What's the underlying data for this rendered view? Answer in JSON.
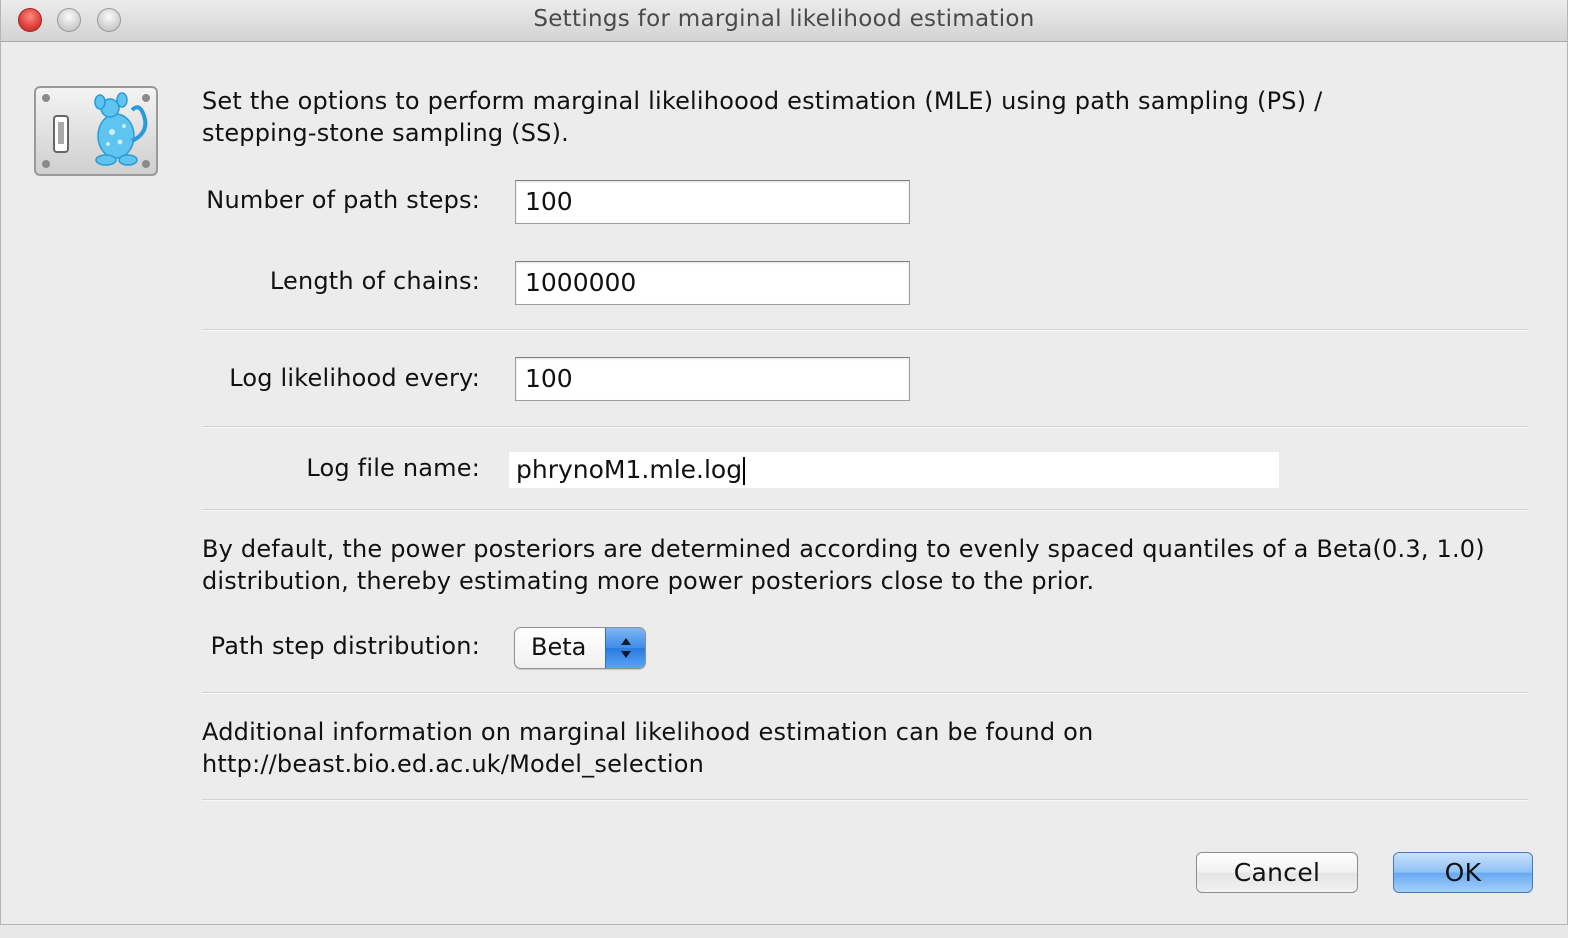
{
  "window": {
    "title": "Settings for marginal likelihood estimation"
  },
  "intro_text_line1": "Set the options to perform marginal likelihoood estimation (MLE) using path sampling (PS) /",
  "intro_text_line2": "stepping-stone sampling (SS).",
  "fields": {
    "path_steps": {
      "label": "Number of path steps:",
      "value": "100"
    },
    "chain_length": {
      "label": "Length of chains:",
      "value": "1000000"
    },
    "log_every": {
      "label": "Log likelihood every:",
      "value": "100"
    },
    "log_file": {
      "label": "Log file name:",
      "value": "phrynoM1.mle.log"
    }
  },
  "default_text_line1": "By default, the power posteriors are determined according to evenly spaced quantiles of a Beta(0.3, 1.0)",
  "default_text_line2": "distribution, thereby estimating more power posteriors close to the prior.",
  "distribution": {
    "label": "Path step distribution:",
    "selected": "Beta"
  },
  "info_text_line1": "Additional information on marginal likelihood estimation can be found on",
  "info_text_line2": "http://beast.bio.ed.ac.uk/Model_selection",
  "buttons": {
    "cancel": "Cancel",
    "ok": "OK"
  },
  "colors": {
    "window_bg": "#ececec",
    "default_button_blue": "#68a9f1",
    "close_red": "#e0443e"
  },
  "icons": {
    "app": "beast-app-icon",
    "close": "close-icon",
    "minimize": "minimize-icon",
    "zoom": "zoom-icon",
    "select_arrows": "chevron-updown-icon"
  }
}
